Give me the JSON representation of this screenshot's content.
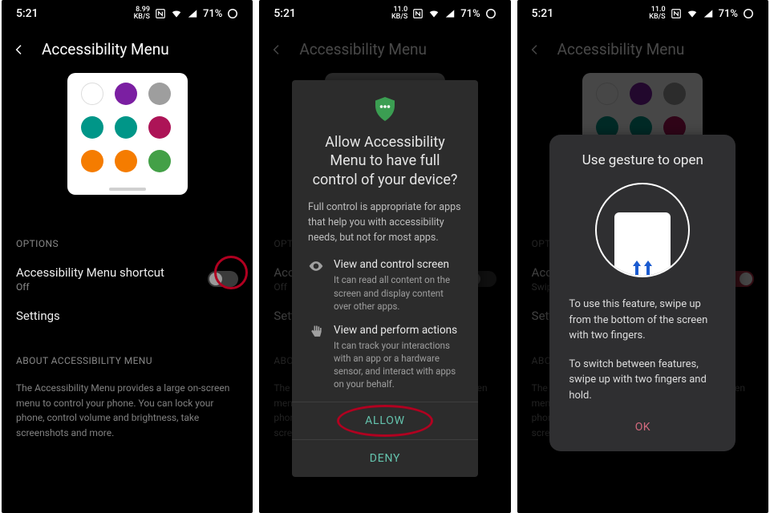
{
  "status": {
    "time": "5:21",
    "speed1": "8.99",
    "speed_unit": "KB/S",
    "speed2": "11.0",
    "battery": "71%"
  },
  "header": {
    "title": "Accessibility Menu"
  },
  "preview": {
    "dots": [
      {
        "bg": "#ffffff",
        "name": "assistant-icon"
      },
      {
        "bg": "#7b1fa2",
        "name": "accessibility-icon"
      },
      {
        "bg": "#9e9e9e",
        "name": "power-icon"
      },
      {
        "bg": "#009688",
        "name": "volume-down-icon"
      },
      {
        "bg": "#009688",
        "name": "volume-up-icon"
      },
      {
        "bg": "#ad1457",
        "name": "recent-icon"
      },
      {
        "bg": "#f57c00",
        "name": "brightness-down-icon"
      },
      {
        "bg": "#f57c00",
        "name": "brightness-up-icon"
      },
      {
        "bg": "#43a047",
        "name": "lock-icon"
      }
    ]
  },
  "options_label": "OPTIONS",
  "shortcut": {
    "label": "Accessibility Menu shortcut",
    "sub_off": "Off",
    "sub_swipe": "Swipe"
  },
  "settings_label": "Settings",
  "about_label": "ABOUT ACCESSIBILITY MENU",
  "about_text": "The Accessibility Menu provides a large on-screen menu to control your phone. You can lock your phone, control volume and brightness, take screenshots and more.",
  "dialog": {
    "title": "Allow Accessibility Menu to have full control of your device?",
    "intro": "Full control is appropriate for apps that help you with accessibility needs, but not for most apps.",
    "perm1_t": "View and control screen",
    "perm1_d": "It can read all content on the screen and display content over other apps.",
    "perm2_t": "View and perform actions",
    "perm2_d": "It can track your interactions with an app or a hardware sensor, and interact with apps on your behalf.",
    "allow": "ALLOW",
    "deny": "DENY"
  },
  "card": {
    "title": "Use gesture to open",
    "p1": "To use this feature, swipe up from the bottom of the screen with two fingers.",
    "p2": "To switch between features, swipe up with two fingers and hold.",
    "ok": "OK"
  }
}
